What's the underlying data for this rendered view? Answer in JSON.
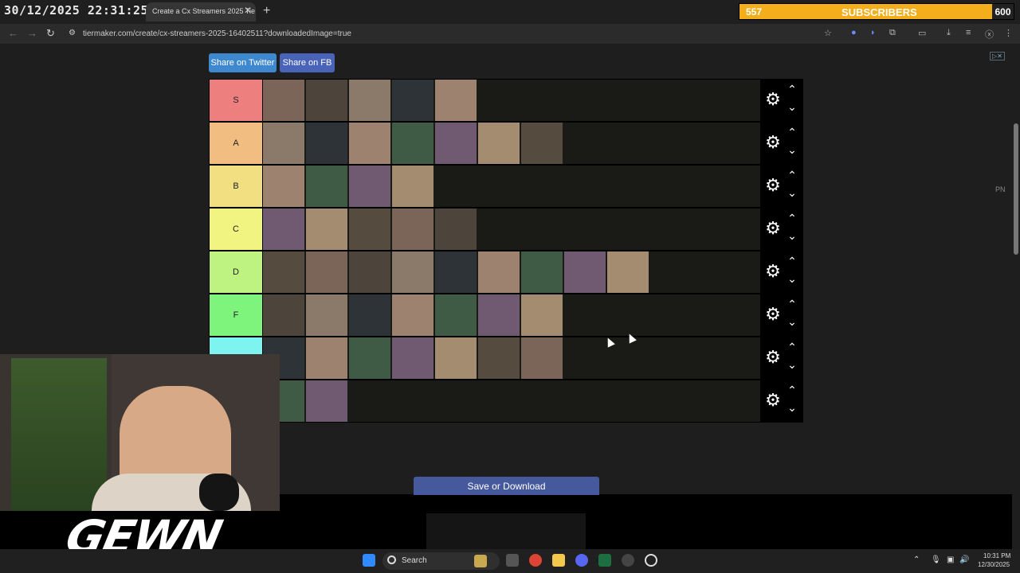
{
  "browser": {
    "timestamp": "30/12/2025 22:31:25",
    "tab_title": "Create a Cx Streamers 2025 Tie",
    "url": "tiermaker.com/create/cx-streamers-2025-16402511?downloadedImage=true"
  },
  "subs_widget": {
    "count_left": "557",
    "label": "SUBSCRIBERS",
    "count_right": "600",
    "accent_color": "#f4ad1b"
  },
  "share": {
    "twitter_label": "Share on Twitter",
    "fb_label": "Share on FB"
  },
  "ad": {
    "pn_label": "PN"
  },
  "tiers": [
    {
      "label": "S",
      "color": "#ee7f7f",
      "item_count": 5
    },
    {
      "label": "A",
      "color": "#f2bd81",
      "item_count": 7
    },
    {
      "label": "B",
      "color": "#f2df81",
      "item_count": 4
    },
    {
      "label": "C",
      "color": "#f2f481",
      "item_count": 5
    },
    {
      "label": "D",
      "color": "#bef381",
      "item_count": 9
    },
    {
      "label": "F",
      "color": "#7ef47d",
      "item_count": 7
    },
    {
      "label": "",
      "color": "#7ef4f0",
      "item_count": 7
    },
    {
      "label": "",
      "color": "#7ebff0",
      "item_count": 2
    }
  ],
  "save_label": "Save or Download",
  "webcam_logo": "GEWN",
  "taskbar": {
    "search_label": "Search",
    "time": "10:31 PM",
    "date": "12/30/2025"
  }
}
